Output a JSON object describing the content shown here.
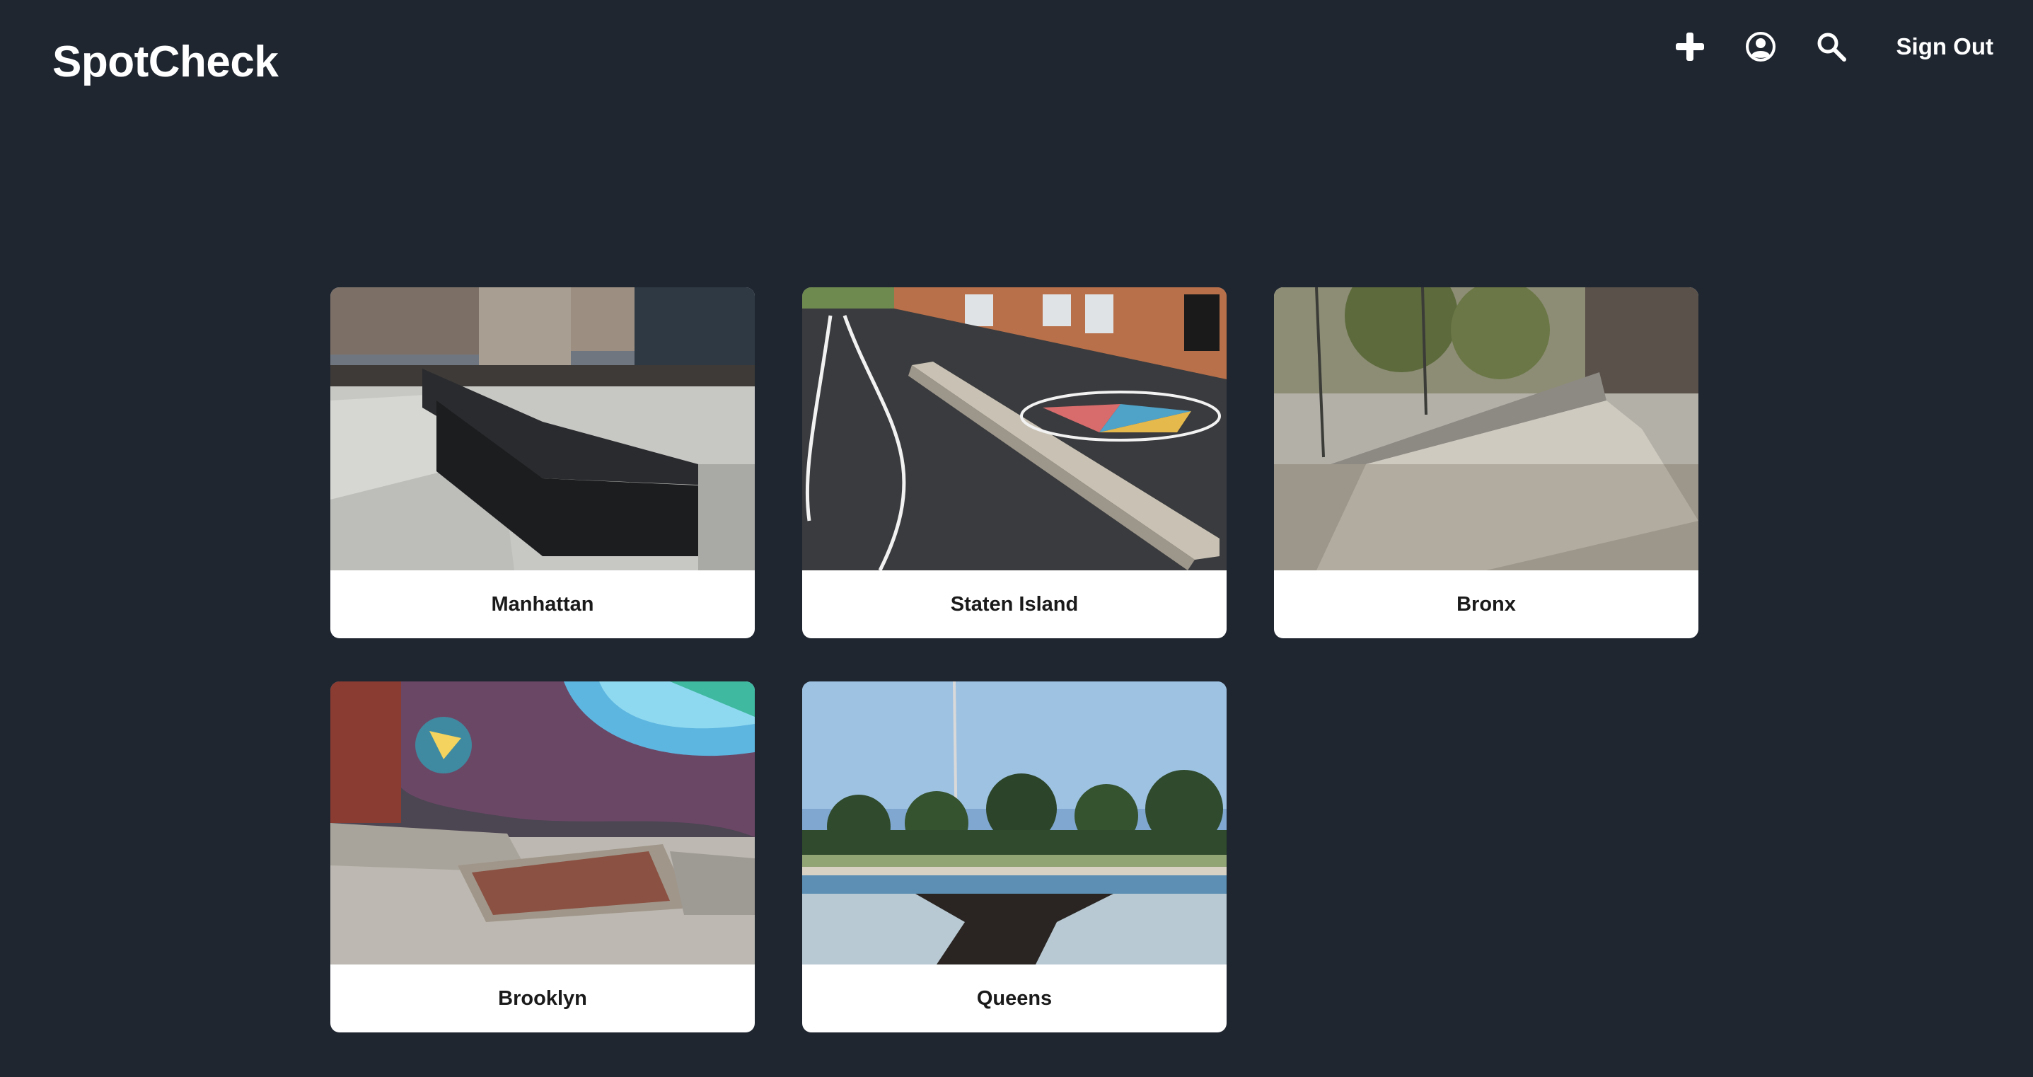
{
  "app": {
    "title": "SpotCheck"
  },
  "nav": {
    "add_icon": "plus-icon",
    "profile_icon": "user-circle-icon",
    "search_icon": "search-icon",
    "sign_out_label": "Sign Out"
  },
  "boroughs": [
    {
      "name": "Manhattan",
      "image": "black granite stair ledge in plaza"
    },
    {
      "name": "Staten Island",
      "image": "concrete ledge in schoolyard"
    },
    {
      "name": "Bronx",
      "image": "concrete bank ramp by fence"
    },
    {
      "name": "Brooklyn",
      "image": "concrete manual pad under mural"
    },
    {
      "name": "Queens",
      "image": "empty pool in park"
    }
  ],
  "colors": {
    "background": "#1f2630",
    "card": "#ffffff",
    "text_light": "#ffffff",
    "text_dark": "#1a1a1a"
  }
}
